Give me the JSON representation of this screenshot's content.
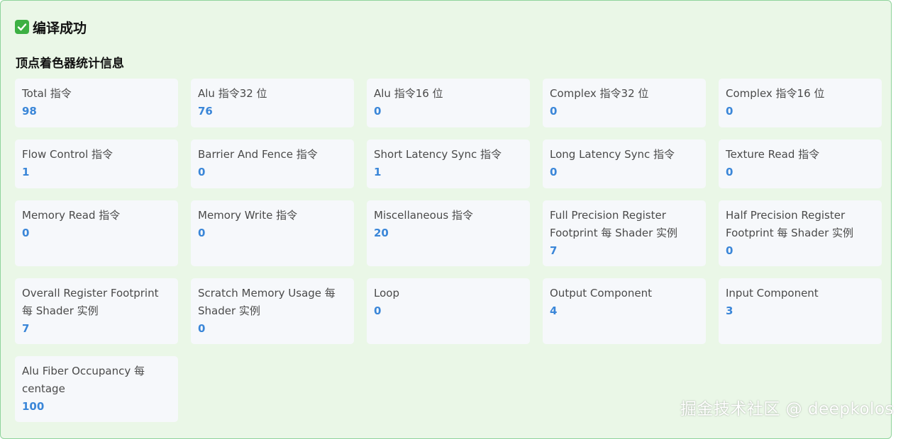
{
  "status": {
    "icon": "check-icon",
    "text": "编译成功",
    "color": "#3cb043"
  },
  "section_title": "顶点着色器统计信息",
  "stats": [
    {
      "label": "Total 指令",
      "value": "98"
    },
    {
      "label": "Alu 指令32 位",
      "value": "76"
    },
    {
      "label": "Alu 指令16 位",
      "value": "0"
    },
    {
      "label": "Complex 指令32 位",
      "value": "0"
    },
    {
      "label": "Complex 指令16 位",
      "value": "0"
    },
    {
      "label": "Flow Control 指令",
      "value": "1"
    },
    {
      "label": "Barrier And Fence 指令",
      "value": "0"
    },
    {
      "label": "Short Latency Sync 指令",
      "value": "1"
    },
    {
      "label": "Long Latency Sync 指令",
      "value": "0"
    },
    {
      "label": "Texture Read 指令",
      "value": "0"
    },
    {
      "label": "Memory Read 指令",
      "value": "0"
    },
    {
      "label": "Memory Write 指令",
      "value": "0"
    },
    {
      "label": "Miscellaneous 指令",
      "value": "20"
    },
    {
      "label": "Full Precision Register Footprint 每 Shader 实例",
      "value": "7"
    },
    {
      "label": "Half Precision Register Footprint 每 Shader 实例",
      "value": "0"
    },
    {
      "label": "Overall Register Footprint 每 Shader 实例",
      "value": "7"
    },
    {
      "label": "Scratch Memory Usage 每 Shader 实例",
      "value": "0"
    },
    {
      "label": "Loop",
      "value": "0"
    },
    {
      "label": "Output Component",
      "value": "4"
    },
    {
      "label": "Input Component",
      "value": "3"
    },
    {
      "label": "Alu Fiber Occupancy 每 centage",
      "value": "100"
    }
  ],
  "watermark": "掘金技术社区 @ deepkolos",
  "colors": {
    "value": "#3a86d8",
    "panel_bg": "#eaf7e7",
    "panel_border": "#8fd39b",
    "card_bg": "#f6f8fb"
  }
}
